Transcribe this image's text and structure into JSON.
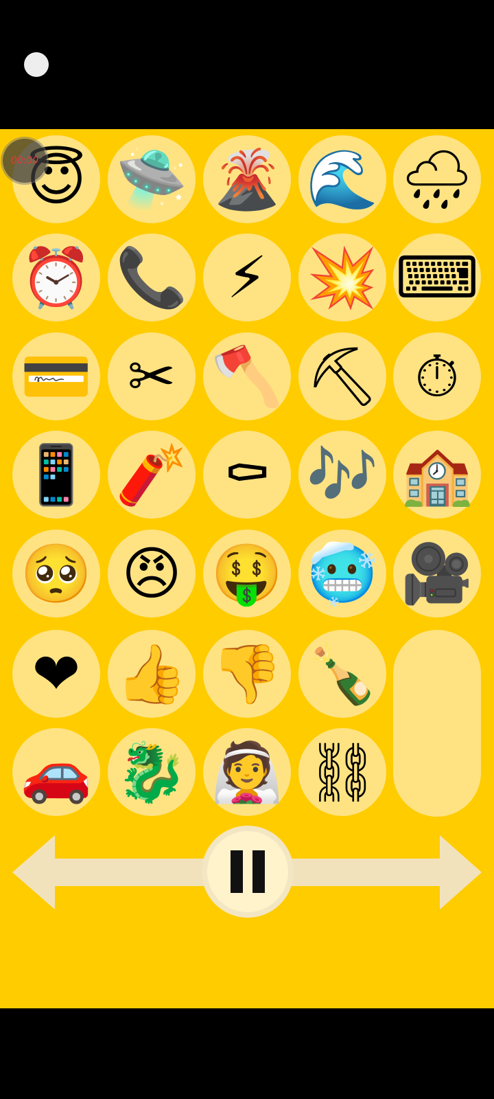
{
  "timer": {
    "text": "00:00"
  },
  "tiles": [
    {
      "name": "smiling-face-with-halo",
      "emoji": "😇"
    },
    {
      "name": "flying-saucer",
      "emoji": "🛸"
    },
    {
      "name": "volcano",
      "emoji": "🌋"
    },
    {
      "name": "water-wave",
      "emoji": "🌊"
    },
    {
      "name": "cloud-with-rain",
      "emoji": "🌧"
    },
    {
      "name": "alarm-clock",
      "emoji": "⏰"
    },
    {
      "name": "telephone-receiver",
      "emoji": "📞"
    },
    {
      "name": "high-voltage",
      "emoji": "⚡"
    },
    {
      "name": "collision",
      "emoji": "💥"
    },
    {
      "name": "keyboard",
      "emoji": "⌨"
    },
    {
      "name": "credit-card",
      "emoji": "💳"
    },
    {
      "name": "scissors",
      "emoji": "✂"
    },
    {
      "name": "axe",
      "emoji": "🪓"
    },
    {
      "name": "pick",
      "emoji": "⛏"
    },
    {
      "name": "stopwatch",
      "emoji": "⏱"
    },
    {
      "name": "mobile-phone",
      "emoji": "📱"
    },
    {
      "name": "firecracker",
      "emoji": "🧨"
    },
    {
      "name": "coffin",
      "emoji": "⚰"
    },
    {
      "name": "musical-notes",
      "emoji": "🎶"
    },
    {
      "name": "school",
      "emoji": "🏫"
    },
    {
      "name": "pleading-face",
      "emoji": "🥺"
    },
    {
      "name": "angry-face",
      "emoji": "😠"
    },
    {
      "name": "money-mouth-face",
      "emoji": "🤑"
    },
    {
      "name": "cold-face",
      "emoji": "🥶"
    },
    {
      "name": "movie-camera",
      "emoji": "🎥"
    },
    {
      "name": "red-heart",
      "emoji": "❤"
    },
    {
      "name": "thumbs-up",
      "emoji": "👍"
    },
    {
      "name": "thumbs-down",
      "emoji": "👎"
    },
    {
      "name": "bottle-with-popping-cork",
      "emoji": "🍾"
    },
    {
      "name": "automobile",
      "emoji": "🚗"
    },
    {
      "name": "dragon",
      "emoji": "🐉"
    },
    {
      "name": "woman-with-veil",
      "emoji": "👰"
    },
    {
      "name": "chains",
      "emoji": "⛓"
    }
  ],
  "colors": {
    "background": "#ffcc00",
    "tile": "#ffe382",
    "arrow": "#f2e2bc",
    "pause_button": "#fff3cc"
  }
}
